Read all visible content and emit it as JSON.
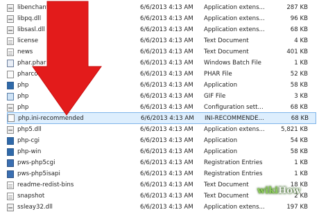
{
  "files": [
    {
      "name": "libenchant_myspell.dll",
      "date": "6/6/2013 4:13 AM",
      "type": "Application extens...",
      "size": "287 KB",
      "icon": "dll-file-icon"
    },
    {
      "name": "libpq.dll",
      "date": "6/6/2013 4:13 AM",
      "type": "Application extens...",
      "size": "96 KB",
      "icon": "dll-file-icon"
    },
    {
      "name": "libsasl.dll",
      "date": "6/6/2013 4:13 AM",
      "type": "Application extens...",
      "size": "68 KB",
      "icon": "dll-file-icon"
    },
    {
      "name": "license",
      "date": "6/6/2013 4:13 AM",
      "type": "Text Document",
      "size": "4 KB",
      "icon": "text-file-icon"
    },
    {
      "name": "news",
      "date": "6/6/2013 4:13 AM",
      "type": "Text Document",
      "size": "401 KB",
      "icon": "text-file-icon"
    },
    {
      "name": "phar.phar",
      "date": "6/6/2013 4:13 AM",
      "type": "Windows Batch File",
      "size": "1 KB",
      "icon": "batch-file-icon"
    },
    {
      "name": "pharcommand",
      "date": "6/6/2013 4:13 AM",
      "type": "PHAR File",
      "size": "52 KB",
      "icon": "generic-file-icon"
    },
    {
      "name": "php",
      "date": "6/6/2013 4:13 AM",
      "type": "Application",
      "size": "58 KB",
      "icon": "php-app-icon"
    },
    {
      "name": "php",
      "date": "6/6/2013 4:13 AM",
      "type": "GIF File",
      "size": "3 KB",
      "icon": "gif-file-icon"
    },
    {
      "name": "php",
      "date": "6/6/2013 4:13 AM",
      "type": "Configuration sett...",
      "size": "68 KB",
      "icon": "config-file-icon"
    },
    {
      "name": "php.ini-recommended",
      "date": "6/6/2013 4:13 AM",
      "type": "INI-RECOMMENDE...",
      "size": "68 KB",
      "icon": "generic-file-icon"
    },
    {
      "name": "php5.dll",
      "date": "6/6/2013 4:13 AM",
      "type": "Application extens...",
      "size": "5,821 KB",
      "icon": "dll-file-icon"
    },
    {
      "name": "php-cgi",
      "date": "6/6/2013 4:13 AM",
      "type": "Application",
      "size": "54 KB",
      "icon": "php-app-icon"
    },
    {
      "name": "php-win",
      "date": "6/6/2013 4:13 AM",
      "type": "Application",
      "size": "58 KB",
      "icon": "php-app-icon"
    },
    {
      "name": "pws-php5cgi",
      "date": "6/6/2013 4:13 AM",
      "type": "Registration Entries",
      "size": "1 KB",
      "icon": "registry-file-icon"
    },
    {
      "name": "pws-php5isapi",
      "date": "6/6/2013 4:13 AM",
      "type": "Registration Entries",
      "size": "1 KB",
      "icon": "registry-file-icon"
    },
    {
      "name": "readme-redist-bins",
      "date": "6/6/2013 4:13 AM",
      "type": "Text Document",
      "size": "18 KB",
      "icon": "text-file-icon"
    },
    {
      "name": "snapshot",
      "date": "6/6/2013 4:13 AM",
      "type": "Text Document",
      "size": "2 KB",
      "icon": "text-file-icon"
    },
    {
      "name": "ssleay32.dll",
      "date": "6/6/2013 4:13 AM",
      "type": "Application extens...",
      "size": "197 KB",
      "icon": "dll-file-icon"
    }
  ],
  "selected_index": 10,
  "annotation": {
    "icon": "red-down-arrow-icon",
    "color": "#e31b1b"
  },
  "watermark": {
    "part1": "wiki",
    "part2": "How"
  }
}
